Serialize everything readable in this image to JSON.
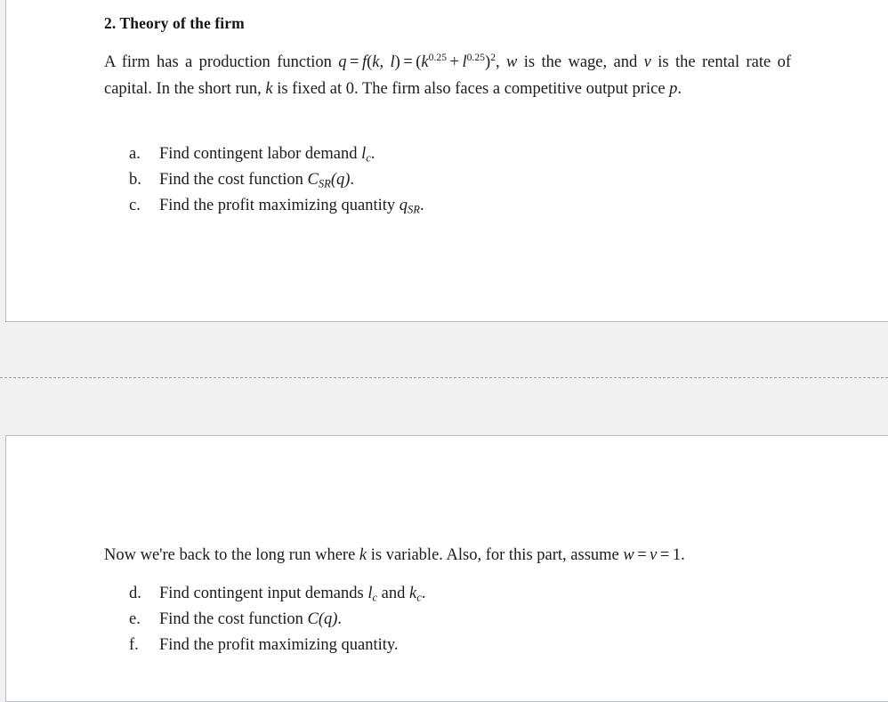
{
  "viewer": {
    "background_color": "#f1f1f1",
    "page_color": "#ffffff",
    "page_border_color": "#b6bec6",
    "divider_color": "#9a9a9a"
  },
  "page_one": {
    "heading": "2. Theory of the firm",
    "paragraph": {
      "seg_1": "A firm has a production function ",
      "math_q": "q",
      "eq_1": "=",
      "math_f": "f",
      "fn_open": "(",
      "math_k1": "k",
      "comma": ", ",
      "math_l1": "l",
      "fn_close": ")",
      "eq_2": "=",
      "paren_open": "(",
      "math_k2": "k",
      "exp_k": "0.25",
      "plus": "+",
      "math_l2": "l",
      "exp_l": "0.25",
      "paren_close": ")",
      "exp_outer": "2",
      "seg_2": ", ",
      "math_w": "w",
      "seg_3": " is the wage, and ",
      "math_v": "v",
      "seg_4": " is the rental rate of capital. In the short run, ",
      "math_k3": "k",
      "seg_5": " is fixed at 0. The firm also faces a competitive output price ",
      "math_p": "p",
      "seg_6": "."
    },
    "items": [
      {
        "marker": "a.",
        "text_before": "Find contingent labor demand ",
        "math_var": "l",
        "math_sub": "c",
        "text_after": "."
      },
      {
        "marker": "b.",
        "text_before": "Find the cost function ",
        "math_var": "C",
        "math_sub": "SR",
        "math_arg_open": "(",
        "math_arg": "q",
        "math_arg_close": ")",
        "text_after": "."
      },
      {
        "marker": "c.",
        "text_before": "Find the profit maximizing quantity ",
        "math_var": "q",
        "math_sub": "SR",
        "text_after": "."
      }
    ]
  },
  "page_two": {
    "paragraph": {
      "seg_1": "Now we're back to the long run where ",
      "math_k": "k",
      "seg_2": " is variable. Also, for this part, assume ",
      "math_w": "w",
      "eq_1": "=",
      "math_v": "v",
      "eq_2": "=",
      "num_one": "1",
      "seg_3": "."
    },
    "items": [
      {
        "marker": "d.",
        "text_before": "Find contingent input demands ",
        "math_var": "l",
        "math_sub": "c",
        "text_middle": " and ",
        "math_var_2": "k",
        "math_sub_2": "c",
        "text_after": "."
      },
      {
        "marker": "e.",
        "text_before": "Find the cost function ",
        "math_var": "C",
        "math_arg_open": "(",
        "math_arg": "q",
        "math_arg_close": ")",
        "text_after": "."
      },
      {
        "marker": "f.",
        "text_before": "Find the profit maximizing quantity.",
        "text_after": ""
      }
    ]
  }
}
